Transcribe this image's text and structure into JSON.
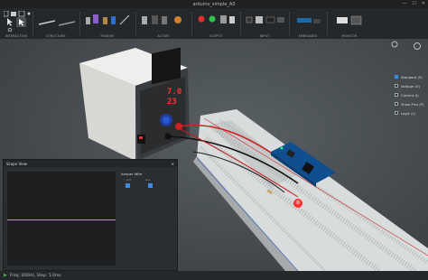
{
  "window": {
    "title": "arduino_simple_A0",
    "controls": [
      "—",
      "☐",
      "✕"
    ]
  },
  "toolbar": {
    "groups": [
      {
        "label": "INTERACTION"
      },
      {
        "label": "STRUCTURE"
      },
      {
        "label": "PASSIVE"
      },
      {
        "label": "ACTIVE"
      },
      {
        "label": "OUTPUT"
      },
      {
        "label": "INPUT"
      },
      {
        "label": "EMBEDDED"
      },
      {
        "label": "MONITOR"
      }
    ]
  },
  "power_supply": {
    "voltage": "7.0",
    "current": "23"
  },
  "legend": {
    "items": [
      {
        "label": "Standard (S)",
        "checked": true
      },
      {
        "label": "Voltage (V)",
        "checked": false
      },
      {
        "label": "Current (I)",
        "checked": false
      },
      {
        "label": "Show Pins (P)",
        "checked": false
      },
      {
        "label": "Logic (L)",
        "checked": false
      }
    ]
  },
  "scope": {
    "title": "Scope View",
    "close": "✕",
    "channel_title": "Jumper Wire",
    "channel_sub": [
      "A V",
      "A A"
    ]
  },
  "status": {
    "text": "Freq: 200Hz, Step: 5.0ms"
  },
  "colors": {
    "accent": "#3b8be8",
    "trace": "#c8a23a",
    "led_red": "#ff2a2a"
  }
}
